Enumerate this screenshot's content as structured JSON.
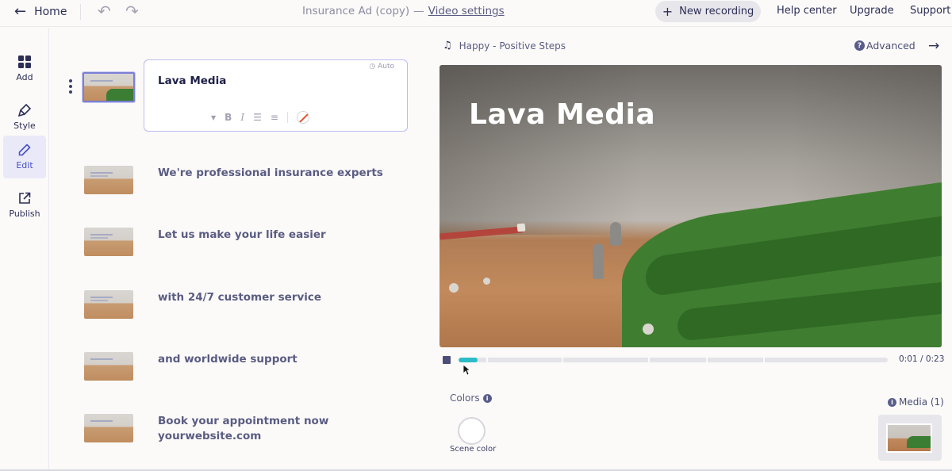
{
  "topbar": {
    "home_label": "Home",
    "doc_title": "Insurance Ad (copy)",
    "title_separator": "—",
    "video_settings": "Video settings",
    "new_recording": "New recording",
    "help_center": "Help center",
    "upgrade": "Upgrade",
    "support": "Support"
  },
  "sidebar": {
    "items": [
      {
        "label": "Add",
        "icon": "grid-icon"
      },
      {
        "label": "Style",
        "icon": "brush-icon"
      },
      {
        "label": "Edit",
        "icon": "pencil-icon"
      },
      {
        "label": "Publish",
        "icon": "share-icon"
      }
    ],
    "active": "Edit"
  },
  "scenes": [
    {
      "text": "Lava Media"
    },
    {
      "text": "We're professional insurance experts"
    },
    {
      "text": "Let us make your life easier"
    },
    {
      "text": "with 24/7 customer service"
    },
    {
      "text": "and worldwide  support"
    },
    {
      "text_line1": "Book your appointment now",
      "text_line2": "yourwebsite.com"
    }
  ],
  "editor": {
    "auto_label": "Auto"
  },
  "player": {
    "music_track": "Happy - Positive Steps",
    "advanced_label": "Advanced",
    "video_title": "Lava Media",
    "current_time": "0:01",
    "time_separator": "/",
    "total_time": "0:23",
    "progress_fraction": 0.045
  },
  "bottom": {
    "colors_label": "Colors",
    "scene_color_label": "Scene color",
    "media_label": "Media (1)"
  },
  "colors": {
    "accent": "#4b50c8",
    "progress": "#2cbcc7",
    "selection_border": "#7b7fd6"
  }
}
